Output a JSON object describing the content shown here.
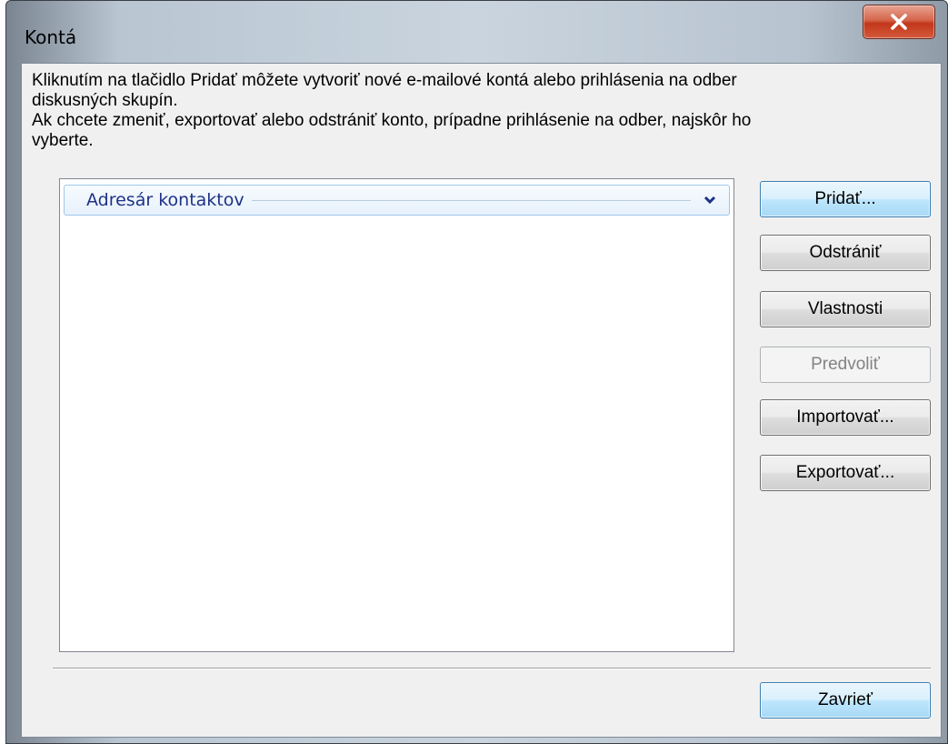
{
  "window": {
    "title": "Kontá",
    "close_label": "✕"
  },
  "description": {
    "line1": "Kliknutím na tlačidlo Pridať môžete vytvoriť nové e-mailové kontá alebo prihlásenia na odber",
    "line2": "diskusných skupín.",
    "line3": "Ak chcete zmeniť, exportovať alebo odstrániť konto, prípadne prihlásenie na odber, najskôr ho",
    "line4": "vyberte."
  },
  "accounts_list": {
    "group_label": "Adresár kontaktov",
    "items": []
  },
  "buttons": {
    "add": "Pridať...",
    "remove": "Odstrániť",
    "properties": "Vlastnosti",
    "set_default": "Predvoliť",
    "import": "Importovať...",
    "export": "Exportovať...",
    "close": "Zavrieť"
  },
  "button_states": {
    "set_default_enabled": false
  },
  "colors": {
    "group_header_text": "#1e3287",
    "primary_button": "#bee6fd",
    "close_button": "#c2371b"
  },
  "icons": {
    "close": "close-icon",
    "group_expand": "chevron-down-icon"
  }
}
